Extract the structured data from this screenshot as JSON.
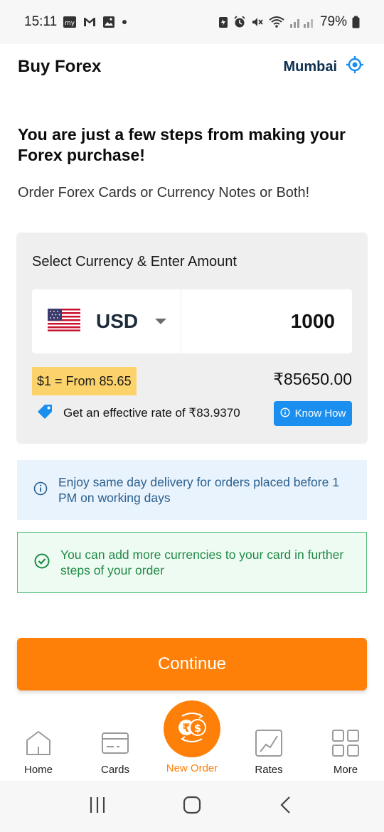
{
  "status_bar": {
    "time": "15:11",
    "battery": "79%",
    "icons_left": [
      "myntra-icon",
      "gmail-icon",
      "gallery-icon",
      "dot-icon"
    ],
    "icons_right": [
      "battery-saver-icon",
      "alarm-icon",
      "mute-icon",
      "wifi-icon",
      "signal-icon",
      "battery-icon"
    ]
  },
  "header": {
    "title": "Buy Forex",
    "location": "Mumbai"
  },
  "main": {
    "headline": "You are just a few steps from making your Forex purchase!",
    "subline": "Order Forex Cards or Currency Notes or Both!"
  },
  "currency_card": {
    "label": "Select Currency & Enter Amount",
    "currency_code": "USD",
    "amount": "1000",
    "rate_badge": "$1 = From 85.65",
    "inr_total": "₹85650.00",
    "effective_rate": "Get an effective rate of ₹83.9370",
    "know_how_label": "Know How"
  },
  "notices": {
    "delivery": "Enjoy same day delivery for orders placed before 1 PM on working days",
    "currencies": "You can add more currencies to your card in further steps of your order"
  },
  "continue_label": "Continue",
  "bottom_nav": {
    "items": [
      {
        "label": "Home",
        "icon": "home-icon"
      },
      {
        "label": "Cards",
        "icon": "card-icon"
      },
      {
        "label": "New Order",
        "icon": "currency-exchange-icon"
      },
      {
        "label": "Rates",
        "icon": "chart-icon"
      },
      {
        "label": "More",
        "icon": "grid-icon"
      }
    ]
  },
  "colors": {
    "accent_orange": "#ff8008",
    "badge_yellow": "#fcd36b",
    "info_blue": "#1a8ff0",
    "success_green": "#1f8a45"
  }
}
